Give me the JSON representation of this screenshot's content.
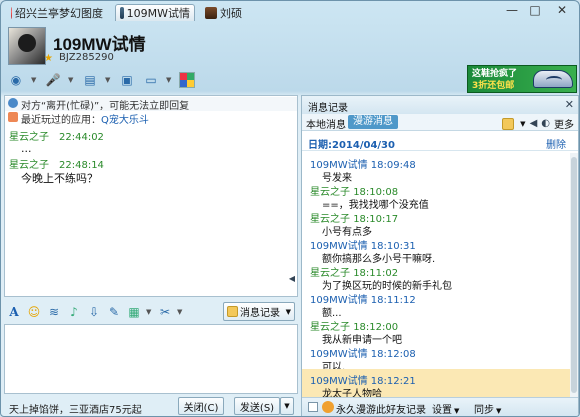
{
  "tabs": [
    {
      "label": "绍兴兰亭梦幻图度"
    },
    {
      "label": "109MW试情"
    },
    {
      "label": "刘硕"
    }
  ],
  "window_controls": {
    "minimize": "—",
    "maximize": "□",
    "close": "✕"
  },
  "contact": {
    "name": "109MW试情",
    "id": "BJZ285290"
  },
  "ad_banner": {
    "line1": "这鞋抢疯了",
    "line2": "3折还包邮"
  },
  "chat": {
    "notice": "对方“离开(忙碌)”，可能无法立即回复",
    "recent_app_label": "最近玩过的应用：",
    "recent_app_link": "Q宠大乐斗",
    "messages": [
      {
        "sender": "星云之子",
        "time": "22:44:02",
        "text": "..."
      },
      {
        "sender": "星云之子",
        "time": "22:48:14",
        "text": "今晚上不练吗？"
      }
    ]
  },
  "input_toolbar": {
    "history_button": "消息记录"
  },
  "bottom_bar": {
    "ad_text": "天上掉馅饼，三亚酒店75元起",
    "close_button": "关闭(C)",
    "send_button": "发送(S)"
  },
  "history": {
    "title": "消息记录",
    "tab_local": "本地消息",
    "tab_roam": "漫游消息",
    "more": "更多",
    "date_label": "日期:2014/04/30",
    "delete_label": "删除",
    "entries": [
      {
        "sender": "109MW试情",
        "time": "18:09:48",
        "text": "号发来",
        "self": false
      },
      {
        "sender": "星云之子",
        "time": "18:10:08",
        "text": "==，我找找哪个没充值",
        "self": true
      },
      {
        "sender": "星云之子",
        "time": "18:10:17",
        "text": "小号有点多",
        "self": true
      },
      {
        "sender": "109MW试情",
        "time": "18:10:31",
        "text": "额你搞那么多小号干嘛呀.",
        "self": false
      },
      {
        "sender": "星云之子",
        "time": "18:11:02",
        "text": "为了换区玩的时候的新手礼包",
        "self": true
      },
      {
        "sender": "109MW试情",
        "time": "18:11:12",
        "text": "额...",
        "self": false
      },
      {
        "sender": "星云之子",
        "time": "18:12:00",
        "text": "我从新申请一个吧",
        "self": true
      },
      {
        "sender": "109MW试情",
        "time": "18:12:08",
        "text": "可以.",
        "self": false
      },
      {
        "sender": "109MW试情",
        "time": "18:12:21",
        "text": "龙太子人物哈",
        "self": false
      }
    ],
    "footer_roam": "永久漫游此好友记录",
    "footer_settings": "设置",
    "footer_sync": "同步"
  },
  "colors": {
    "accent": "#4f98c9",
    "contact_name_color": "#1b5fb0",
    "self_name_color": "#2a8a2a",
    "highlight_row": "#fbe8b4"
  }
}
